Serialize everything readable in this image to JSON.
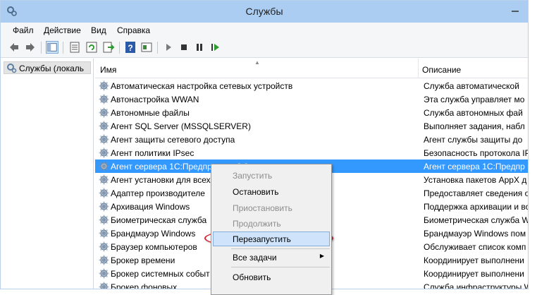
{
  "window": {
    "title": "Службы"
  },
  "menu": [
    "Файл",
    "Действие",
    "Вид",
    "Справка"
  ],
  "toolbar": {
    "icons": [
      "back-icon",
      "forward-icon",
      "show-tree-icon",
      "properties-icon",
      "refresh-icon",
      "export-icon",
      "help-icon",
      "view-icon",
      "play-icon",
      "stop-icon",
      "pause-icon",
      "resume-icon"
    ]
  },
  "tree": {
    "root": "Службы (локаль"
  },
  "columns": {
    "name": "Имя",
    "description": "Описание"
  },
  "rows": [
    {
      "name": "Автоматическая настройка сетевых устройств",
      "desc": "Служба автоматической"
    },
    {
      "name": "Автонастройка WWAN",
      "desc": "Эта служба управляет мо"
    },
    {
      "name": "Автономные файлы",
      "desc": "Служба автономных фай"
    },
    {
      "name": "Агент SQL Server (MSSQLSERVER)",
      "desc": "Выполняет задания, набл"
    },
    {
      "name": "Агент защиты сетевого доступа",
      "desc": "Агент службы защиты до"
    },
    {
      "name": "Агент политики IPsec",
      "desc": "Безопасность протокола IP"
    },
    {
      "name": "Агент сервера 1С:Предприятия 8.3",
      "desc": "Агент сервера 1С:Предпр"
    },
    {
      "name": "Агент установки для всех",
      "desc": "Установка пакетов AppX д"
    },
    {
      "name": "Адаптер производителе",
      "desc": "Предоставляет сведения о"
    },
    {
      "name": "Архивация Windows",
      "desc": "Поддержка архивации и во"
    },
    {
      "name": "Биометрическая служба",
      "desc": "Биометрическая служба W"
    },
    {
      "name": "Брандмауэр Windows",
      "desc": "Брандмауэр Windows пом"
    },
    {
      "name": "Браузер компьютеров",
      "desc": "Обслуживает список комп"
    },
    {
      "name": "Брокер времени",
      "desc": "Координирует выполнени"
    },
    {
      "name": "Брокер системных событ",
      "desc": "Координирует выполнени"
    },
    {
      "name": "Брокер фоновых",
      "desc": "Служба инфраструктуры W"
    }
  ],
  "context_menu": {
    "items": [
      {
        "label": "Запустить",
        "disabled": true
      },
      {
        "label": "Остановить",
        "disabled": false
      },
      {
        "label": "Приостановить",
        "disabled": true
      },
      {
        "label": "Продолжить",
        "disabled": true
      },
      {
        "label": "Перезапустить",
        "disabled": false,
        "highlighted": true
      },
      {
        "label": "Все задачи",
        "disabled": false,
        "submenu": true
      },
      {
        "label": "Обновить",
        "disabled": false
      }
    ]
  },
  "colors": {
    "selection": "#3399ff",
    "titlebar": "#aacdf1",
    "menu_highlight": "#cfe4fa",
    "annotation": "#dc1e2e"
  }
}
